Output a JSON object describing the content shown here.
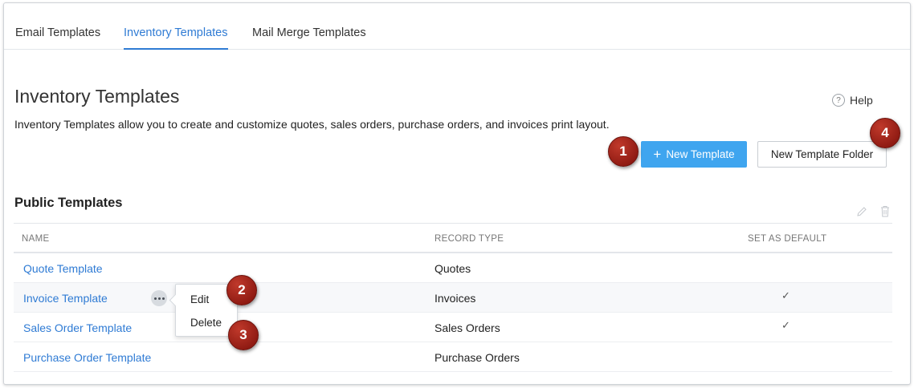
{
  "tabs": [
    {
      "label": "Email Templates",
      "active": false
    },
    {
      "label": "Inventory Templates",
      "active": true
    },
    {
      "label": "Mail Merge Templates",
      "active": false
    }
  ],
  "header": {
    "title": "Inventory Templates",
    "description": "Inventory Templates allow you to create and customize quotes, sales orders, purchase orders, and invoices print layout.",
    "help_label": "Help",
    "help_icon_glyph": "?"
  },
  "actions": {
    "new_template_label": "New Template",
    "new_folder_label": "New Template Folder"
  },
  "badges": [
    "1",
    "2",
    "3",
    "4"
  ],
  "section": {
    "title": "Public Templates"
  },
  "table": {
    "columns": [
      "NAME",
      "RECORD TYPE",
      "SET AS DEFAULT"
    ],
    "rows": [
      {
        "name": "Quote Template",
        "record_type": "Quotes",
        "default": ""
      },
      {
        "name": "Invoice Template",
        "record_type": "Invoices",
        "default": "✓"
      },
      {
        "name": "Sales Order Template",
        "record_type": "Sales Orders",
        "default": "✓"
      },
      {
        "name": "Purchase Order Template",
        "record_type": "Purchase Orders",
        "default": ""
      }
    ]
  },
  "row_menu": {
    "items": [
      "Edit",
      "Delete"
    ]
  },
  "colors": {
    "accent": "#2f7bd4",
    "primary_button": "#3fa5ef",
    "badge": "#a3261b"
  },
  "icons": {
    "help": "help-circle-icon",
    "plus": "plus-icon",
    "edit": "pencil-icon",
    "delete": "trash-icon",
    "more": "more-horizontal-icon",
    "check": "check-icon"
  }
}
